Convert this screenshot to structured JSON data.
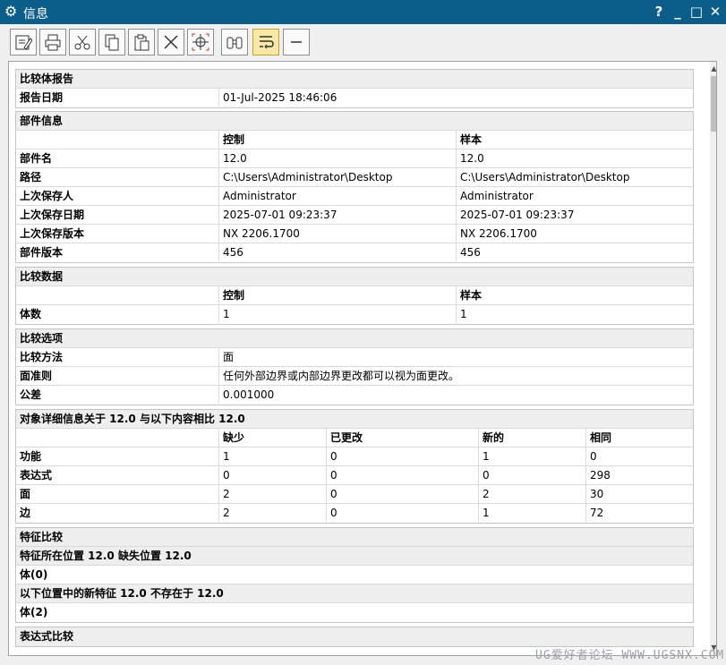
{
  "window": {
    "title": "信息",
    "help": "?",
    "minimize": "_",
    "maximize": "□",
    "close": "✕"
  },
  "toolbar": [
    {
      "name": "save-edit-button",
      "icon": "save-edit-icon"
    },
    {
      "name": "print-button",
      "icon": "printer-icon"
    },
    {
      "name": "cut-button",
      "icon": "scissors-icon"
    },
    {
      "name": "copy-button",
      "icon": "copy-icon"
    },
    {
      "name": "paste-button",
      "icon": "paste-icon"
    },
    {
      "name": "delete-button",
      "icon": "x-icon"
    },
    {
      "name": "select-target-button",
      "icon": "crosshair-icon"
    },
    {
      "name": "find-button",
      "icon": "binoculars-icon"
    },
    {
      "name": "wrap-text-button",
      "icon": "wrap-icon",
      "active": true
    },
    {
      "name": "collapse-button",
      "icon": "minus-icon"
    }
  ],
  "report": {
    "title": "比较体报告",
    "date_label": "报告日期",
    "date_value": "01-Jul-2025 18:46:06"
  },
  "part_info": {
    "title": "部件信息",
    "col_control": "控制",
    "col_sample": "样本",
    "rows": [
      {
        "label": "部件名",
        "control": "12.0",
        "sample": "12.0"
      },
      {
        "label": "路径",
        "control": "C:\\Users\\Administrator\\Desktop",
        "sample": "C:\\Users\\Administrator\\Desktop"
      },
      {
        "label": "上次保存人",
        "control": "Administrator",
        "sample": "Administrator"
      },
      {
        "label": "上次保存日期",
        "control": "2025-07-01 09:23:37",
        "sample": "2025-07-01 09:23:37"
      },
      {
        "label": "上次保存版本",
        "control": "NX 2206.1700",
        "sample": "NX 2206.1700"
      },
      {
        "label": "部件版本",
        "control": "456",
        "sample": "456"
      }
    ]
  },
  "compare_data": {
    "title": "比较数据",
    "col_control": "控制",
    "col_sample": "样本",
    "rows": [
      {
        "label": "体数",
        "control": "1",
        "sample": "1"
      }
    ]
  },
  "compare_options": {
    "title": "比较选项",
    "rows": [
      {
        "label": "比较方法",
        "value": "面"
      },
      {
        "label": "面准则",
        "value": "任何外部边界或内部边界更改都可以视为面更改。"
      },
      {
        "label": "公差",
        "value": "0.001000"
      }
    ]
  },
  "object_details": {
    "title": "对象详细信息关于 12.0 与以下内容相比 12.0",
    "headers": [
      "缺少",
      "已更改",
      "新的",
      "相同"
    ],
    "rows": [
      {
        "label": "功能",
        "values": [
          "1",
          "0",
          "1",
          "0"
        ]
      },
      {
        "label": "表达式",
        "values": [
          "0",
          "0",
          "0",
          "298"
        ]
      },
      {
        "label": "面",
        "values": [
          "2",
          "0",
          "2",
          "30"
        ]
      },
      {
        "label": "边",
        "values": [
          "2",
          "0",
          "1",
          "72"
        ]
      }
    ]
  },
  "feature_compare": {
    "title": "特征比较",
    "missing_title": "特征所在位置 12.0 缺失位置 12.0",
    "missing_body": "体(0)",
    "new_title": "以下位置中的新特征 12.0 不存在于 12.0",
    "new_body": "体(2)"
  },
  "expression_compare": {
    "title": "表达式比较"
  },
  "watermark": "UG爱好者论坛 WWW.UGSNX.COM"
}
